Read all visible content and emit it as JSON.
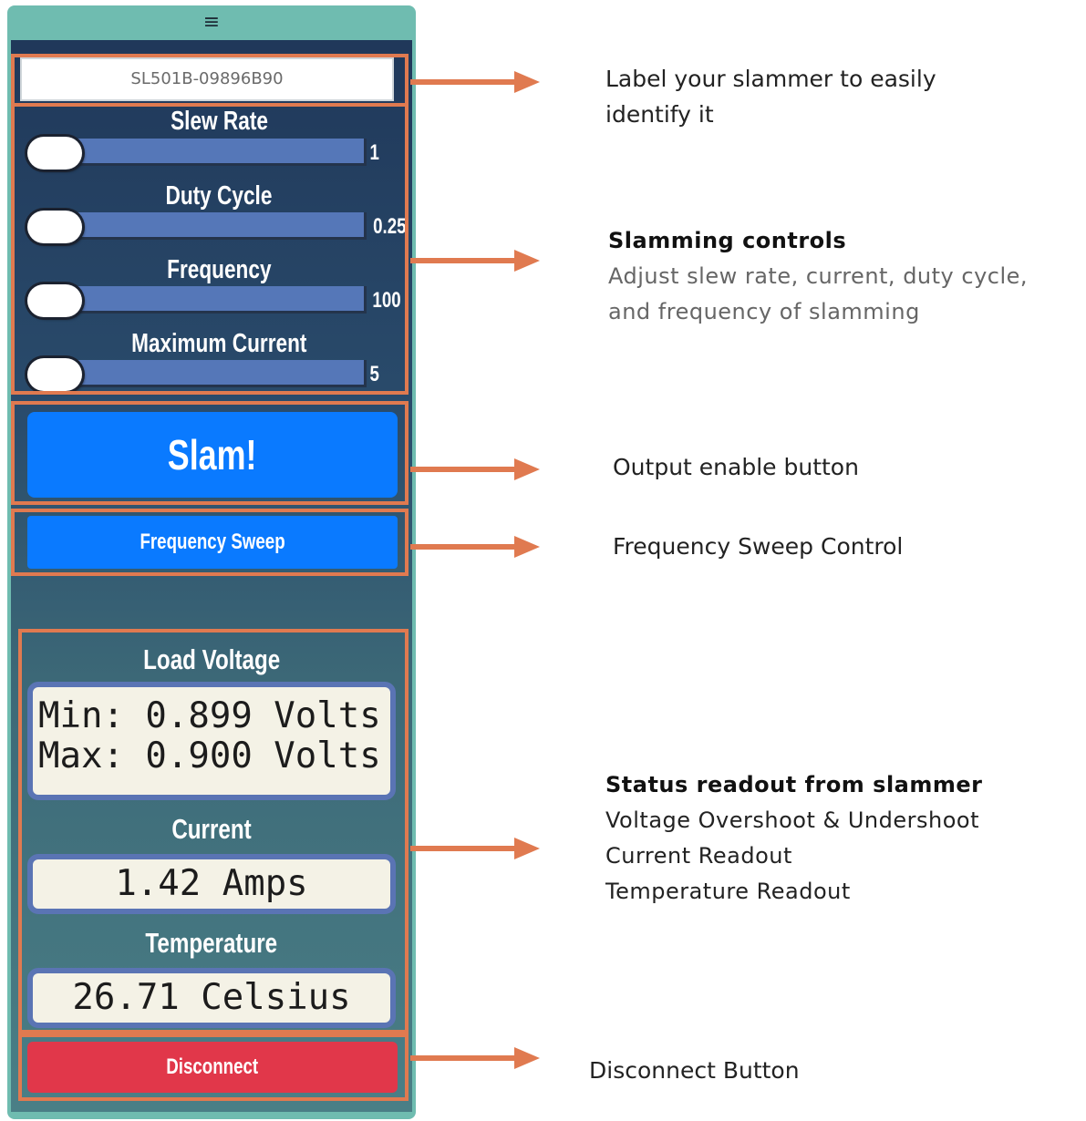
{
  "menu": {
    "icon": "hamburger-menu-icon",
    "glyph": "≡"
  },
  "device": {
    "name_value": "SL501B-09896B90"
  },
  "sliders": [
    {
      "label": "Slew Rate",
      "value": "1"
    },
    {
      "label": "Duty Cycle",
      "value": "0.25"
    },
    {
      "label": "Frequency",
      "value": "100"
    },
    {
      "label": "Maximum Current",
      "value": "5"
    }
  ],
  "buttons": {
    "slam": "Slam!",
    "sweep": "Frequency Sweep",
    "disconnect": "Disconnect"
  },
  "status": {
    "voltage_label": "Load Voltage",
    "voltage_min": "Min: 0.899 Volts",
    "voltage_max": "Max: 0.900 Volts",
    "current_label": "Current",
    "current_value": "1.42 Amps",
    "temperature_label": "Temperature",
    "temperature_value": "26.71 Celsius"
  },
  "annotations": {
    "label": [
      "Label your slammer to easily",
      "identify it"
    ],
    "controls_title": "Slamming controls",
    "controls_desc": [
      "Adjust slew rate, current, duty cycle,",
      "and frequency of slamming"
    ],
    "output": "Output enable button",
    "sweep": "Frequency Sweep Control",
    "status_title": "Status readout from slammer",
    "status_lines": [
      "Voltage Overshoot & Undershoot",
      "Current Readout",
      "Temperature Readout"
    ],
    "disconnect": "Disconnect Button"
  },
  "colors": {
    "annotation": "#e07a50",
    "button_blue": "#0a7aff",
    "disconnect_red": "#e1374a",
    "panel_teal": "#6fbcb0"
  }
}
